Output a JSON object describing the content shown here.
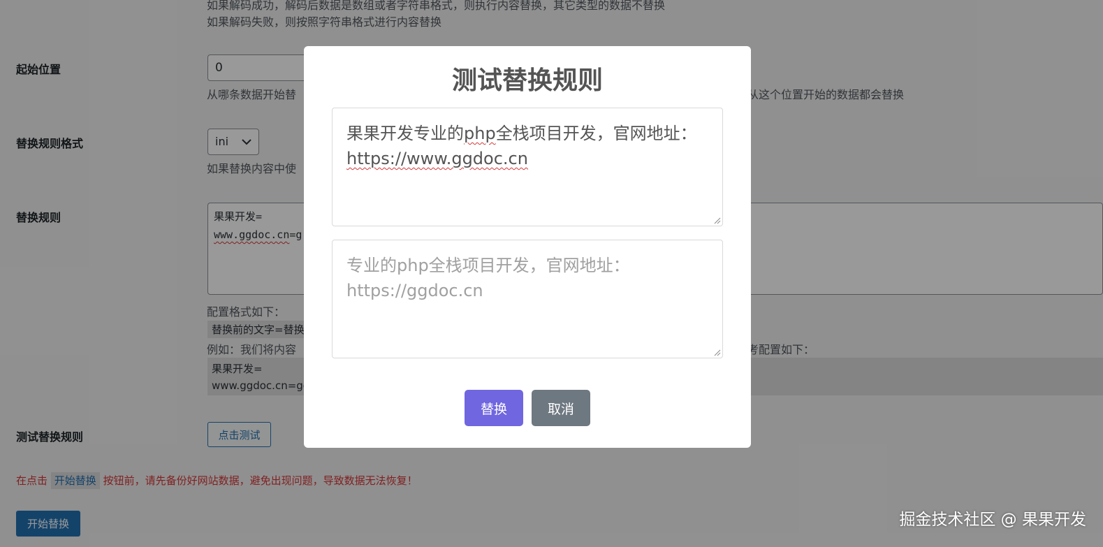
{
  "background_form": {
    "top_desc_line1": "如果解码成功，解码后数据是数组或者字符串格式，则执行内容替换，其它类型的数据不替换",
    "top_desc_line2": "如果解码失败，则按照字符串格式进行内容替换",
    "start_position": {
      "label": "起始位置",
      "value": "0",
      "desc_left": "从哪条数据开始替",
      "desc_right": "从这个位置开始的数据都会替换"
    },
    "rule_format": {
      "label": "替换规则格式",
      "selected": "ini",
      "desc": "如果替换内容中使"
    },
    "rules": {
      "label": "替换规则",
      "value_line1": "果果开发=",
      "value_line2_prefix": "www.ggdoc.cn",
      "value_line2_suffix": "=g",
      "config_note": "配置格式如下：",
      "format_code": "替换前的文字=替换",
      "example_left": "例如：我们将内容",
      "example_right": "考配置如下：",
      "example_code_line1": "果果开发=",
      "example_code_line2": "www.ggdoc.cn=gg"
    },
    "test_rules": {
      "label": "测试替换规则",
      "button": "点击测试"
    },
    "warning": {
      "prefix": "在点击",
      "code": "开始替换",
      "suffix": "按钮前，请先备份好网站数据，避免出现问题，导致数据无法恢复！"
    },
    "start_button": "开始替换"
  },
  "modal": {
    "title": "测试替换规则",
    "input_text_a": "果果开发专业的",
    "input_text_b": "php",
    "input_text_c": "全栈项目开发，官网地址：",
    "input_text_url": "https://www.ggdoc.cn",
    "output_text": "专业的php全栈项目开发，官网地址：https://ggdoc.cn",
    "confirm_button": "替换",
    "cancel_button": "取消"
  },
  "watermark": "掘金技术社区 @ 果果开发",
  "colors": {
    "overlay": "rgba(0,0,0,0.4)",
    "confirm": "#7066e0",
    "cancel": "#6e7881",
    "wp_blue": "#2271b1",
    "warning": "#d63638"
  }
}
